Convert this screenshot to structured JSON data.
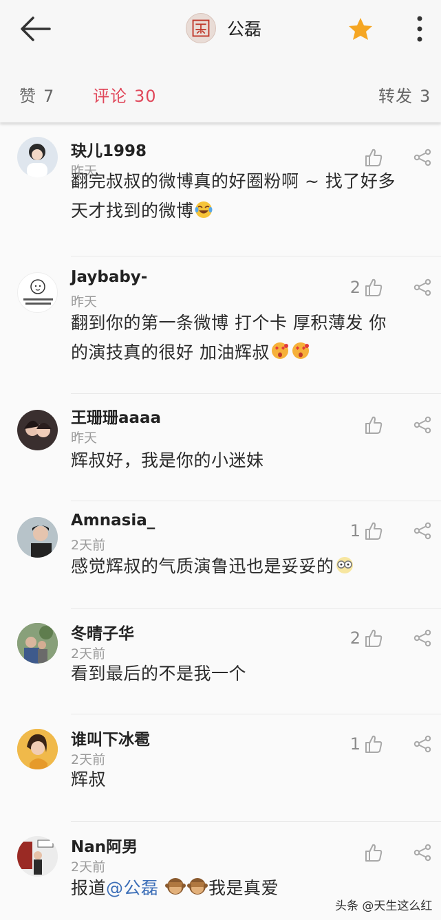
{
  "header": {
    "title": "公磊",
    "back_icon": "arrow-left-icon",
    "star_icon": "star-icon",
    "more_icon": "more-vertical-icon",
    "star_color": "#f5a623"
  },
  "tabs": {
    "likes": {
      "label": "赞",
      "count": "7"
    },
    "comments": {
      "label": "评论",
      "count": "30"
    },
    "reposts": {
      "label": "转发",
      "count": "3"
    },
    "active_color": "#e0475a"
  },
  "comments": [
    {
      "user": "玦儿1998",
      "time": "昨天",
      "likes": "",
      "text_lines": [
        "翻完叔叔的微博真的好圈粉啊 ~ 找了好多",
        "天才找到的微博"
      ],
      "emoji": [
        "laugh-cry-emoji"
      ]
    },
    {
      "user": "Jaybaby-",
      "time": "昨天",
      "likes": "2",
      "text_lines": [
        "翻到你的第一条微博 打个卡 厚积薄发 你",
        "的演技真的很好 加油辉叔"
      ],
      "emoji": [
        "heart-eyes-emoji",
        "heart-eyes-emoji"
      ]
    },
    {
      "user": "王珊珊aaaa",
      "time": "昨天",
      "likes": "",
      "text_lines": [
        "辉叔好，我是你的小迷妹"
      ],
      "emoji": []
    },
    {
      "user": "Amnasia_",
      "time": "2天前",
      "likes": "1",
      "text_lines": [
        "感觉辉叔的气质演鲁迅也是妥妥的"
      ],
      "emoji": [
        "nerd-glasses-emoji"
      ]
    },
    {
      "user": "冬晴子华",
      "time": "2天前",
      "likes": "2",
      "text_lines": [
        "看到最后的不是我一个"
      ],
      "emoji": []
    },
    {
      "user": "谁叫下冰雹",
      "time": "2天前",
      "likes": "1",
      "text_lines": [
        "辉叔"
      ],
      "emoji": []
    },
    {
      "user": "Nan阿男",
      "time": "2天前",
      "likes": "",
      "text_prefix": "报道",
      "mention": "@公磊",
      "text_suffix": "我是真爱",
      "emoji": [
        "see-no-evil-monkey-emoji",
        "see-no-evil-monkey-emoji"
      ]
    }
  ],
  "watermark": "头条 @天生这么红"
}
